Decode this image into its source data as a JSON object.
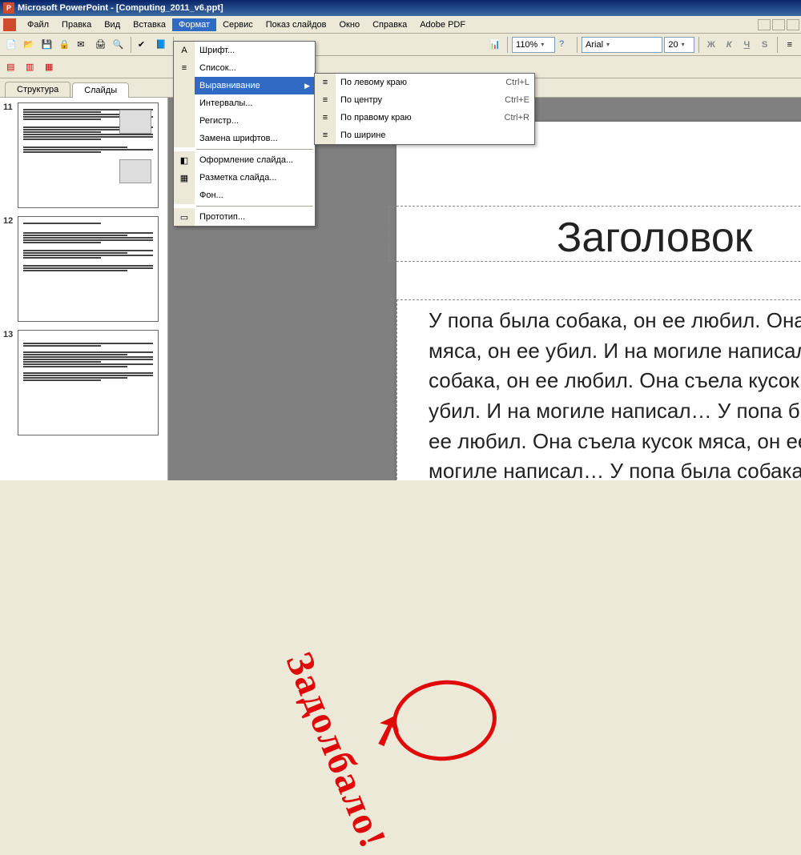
{
  "app": {
    "title": "Microsoft PowerPoint - [Computing_2011_v6.ppt]"
  },
  "menubar": {
    "items": [
      {
        "label": "Файл",
        "u": 0
      },
      {
        "label": "Правка",
        "u": 0
      },
      {
        "label": "Вид",
        "u": 0
      },
      {
        "label": "Вставка",
        "u": 3
      },
      {
        "label": "Формат",
        "u": 3,
        "open": true
      },
      {
        "label": "Сервис",
        "u": 0
      },
      {
        "label": "Показ слайдов",
        "u": 2
      },
      {
        "label": "Окно",
        "u": 0
      },
      {
        "label": "Справка",
        "u": 0
      },
      {
        "label": "Adobe PDF",
        "u": 3
      }
    ]
  },
  "toolbar1": {
    "zoom": "110%",
    "font": "Arial",
    "size": "20"
  },
  "tabs": {
    "structure": "Структура",
    "slides": "Слайды"
  },
  "thumbs": [
    "11",
    "12",
    "13"
  ],
  "dropdown_format": {
    "items": [
      {
        "label": "Шрифт..."
      },
      {
        "label": "Список..."
      },
      {
        "label": "Выравнивание",
        "sub": true,
        "hi": true
      },
      {
        "label": "Интервалы..."
      },
      {
        "label": "Регистр..."
      },
      {
        "label": "Замена шрифтов..."
      },
      {
        "label": "---"
      },
      {
        "label": "Оформление слайда..."
      },
      {
        "label": "Разметка слайда..."
      },
      {
        "label": "Фон..."
      },
      {
        "label": "---"
      },
      {
        "label": "Прототип..."
      }
    ]
  },
  "dropdown_align": {
    "items": [
      {
        "label": "По левому краю",
        "short": "Ctrl+L"
      },
      {
        "label": "По центру",
        "short": "Ctrl+E"
      },
      {
        "label": "По правому краю",
        "short": "Ctrl+R"
      },
      {
        "label": "По ширине",
        "short": ""
      }
    ]
  },
  "slide": {
    "title": "Заголовок",
    "body": "У попа была собака, он ее любил. Она съела кусок мяса, он ее убил. И на могиле написал… У попа была собака, он ее любил. Она съела кусок мяса, он ее убил. И на могиле написал… У попа была собака, он ее любил. Она съела кусок мяса, он ее убил. И на могиле написал… У попа была собака, он ее любил. Она съела кусок мяса, он ее убил. И на могиле написал…"
  },
  "annotation": {
    "text": "Задолбало!"
  }
}
